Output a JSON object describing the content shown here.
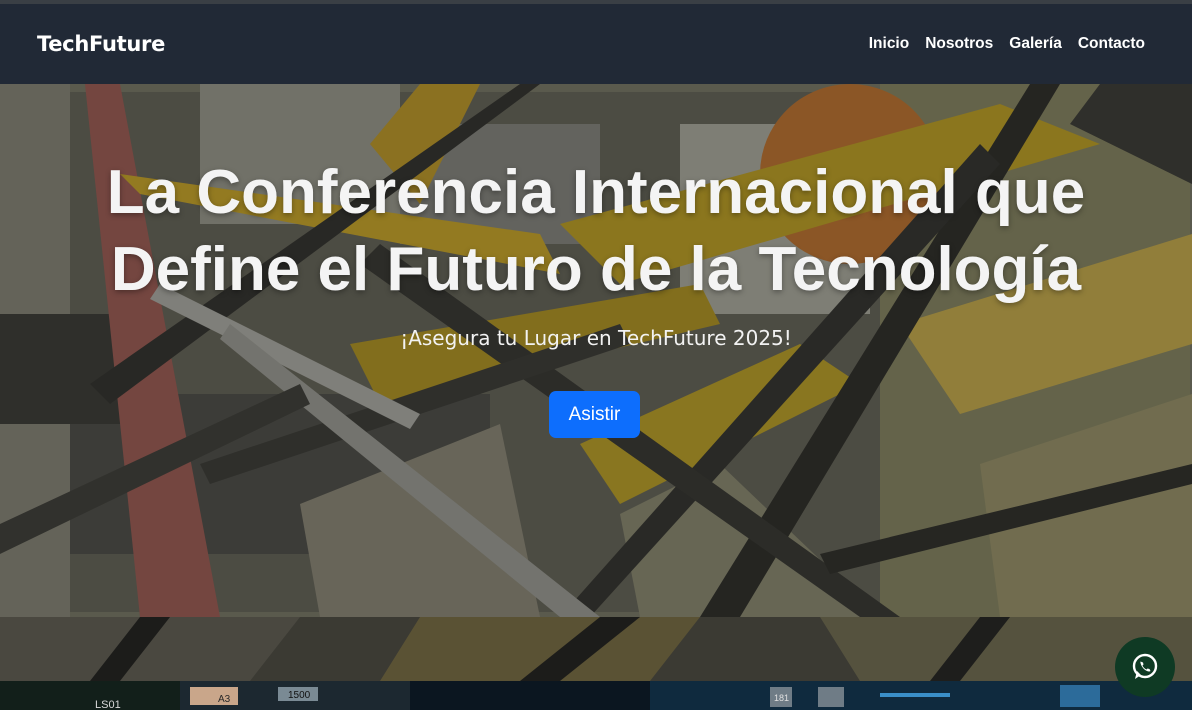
{
  "navbar": {
    "brand": "TechFuture",
    "links": [
      {
        "label": "Inicio"
      },
      {
        "label": "Nosotros"
      },
      {
        "label": "Galería"
      },
      {
        "label": "Contacto"
      }
    ]
  },
  "hero": {
    "title_line1": "La Conferencia Internacional que",
    "title_line2": "Define el Futuro de la Tecnología",
    "subtitle": "¡Asegura tu Lugar en TechFuture 2025!",
    "cta_label": "Asistir",
    "background_icon": "abstract-art-image"
  },
  "strip": {
    "chip_labels": [
      "LS01",
      "A3",
      "1500",
      "181"
    ]
  },
  "floating": {
    "icon": "whatsapp-icon"
  },
  "colors": {
    "navbar_bg": "#212936",
    "cta_bg": "#0d6efd",
    "whatsapp_bg": "#0f3a24",
    "text_light": "#ffffff"
  }
}
